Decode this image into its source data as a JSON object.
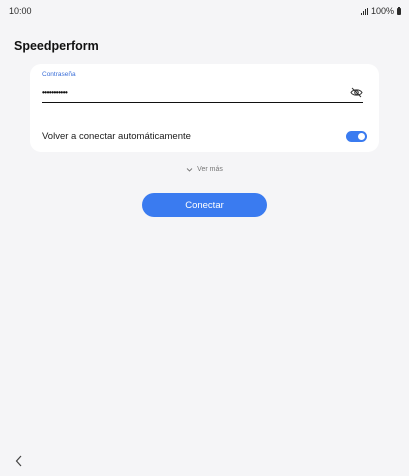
{
  "status_bar": {
    "time": "10:00",
    "battery_percent": "100%",
    "icons": [
      "signal-icon",
      "battery-icon"
    ]
  },
  "network": {
    "name": "Speedperform"
  },
  "password": {
    "label": "Contraseña",
    "masked_value": "•••••••••••",
    "visibility_icon": "eye-off-icon"
  },
  "auto_reconnect": {
    "label": "Volver a conectar automáticamente",
    "enabled": true
  },
  "more": {
    "label": "Ver más",
    "icon": "chevron-down-icon"
  },
  "connect_button": {
    "label": "Conectar"
  },
  "navigation": {
    "back_icon": "back-chevron-icon"
  },
  "colors": {
    "accent": "#3a7bf0",
    "background": "#f5f5f7",
    "card": "#ffffff",
    "label_blue": "#3b6fd8"
  }
}
